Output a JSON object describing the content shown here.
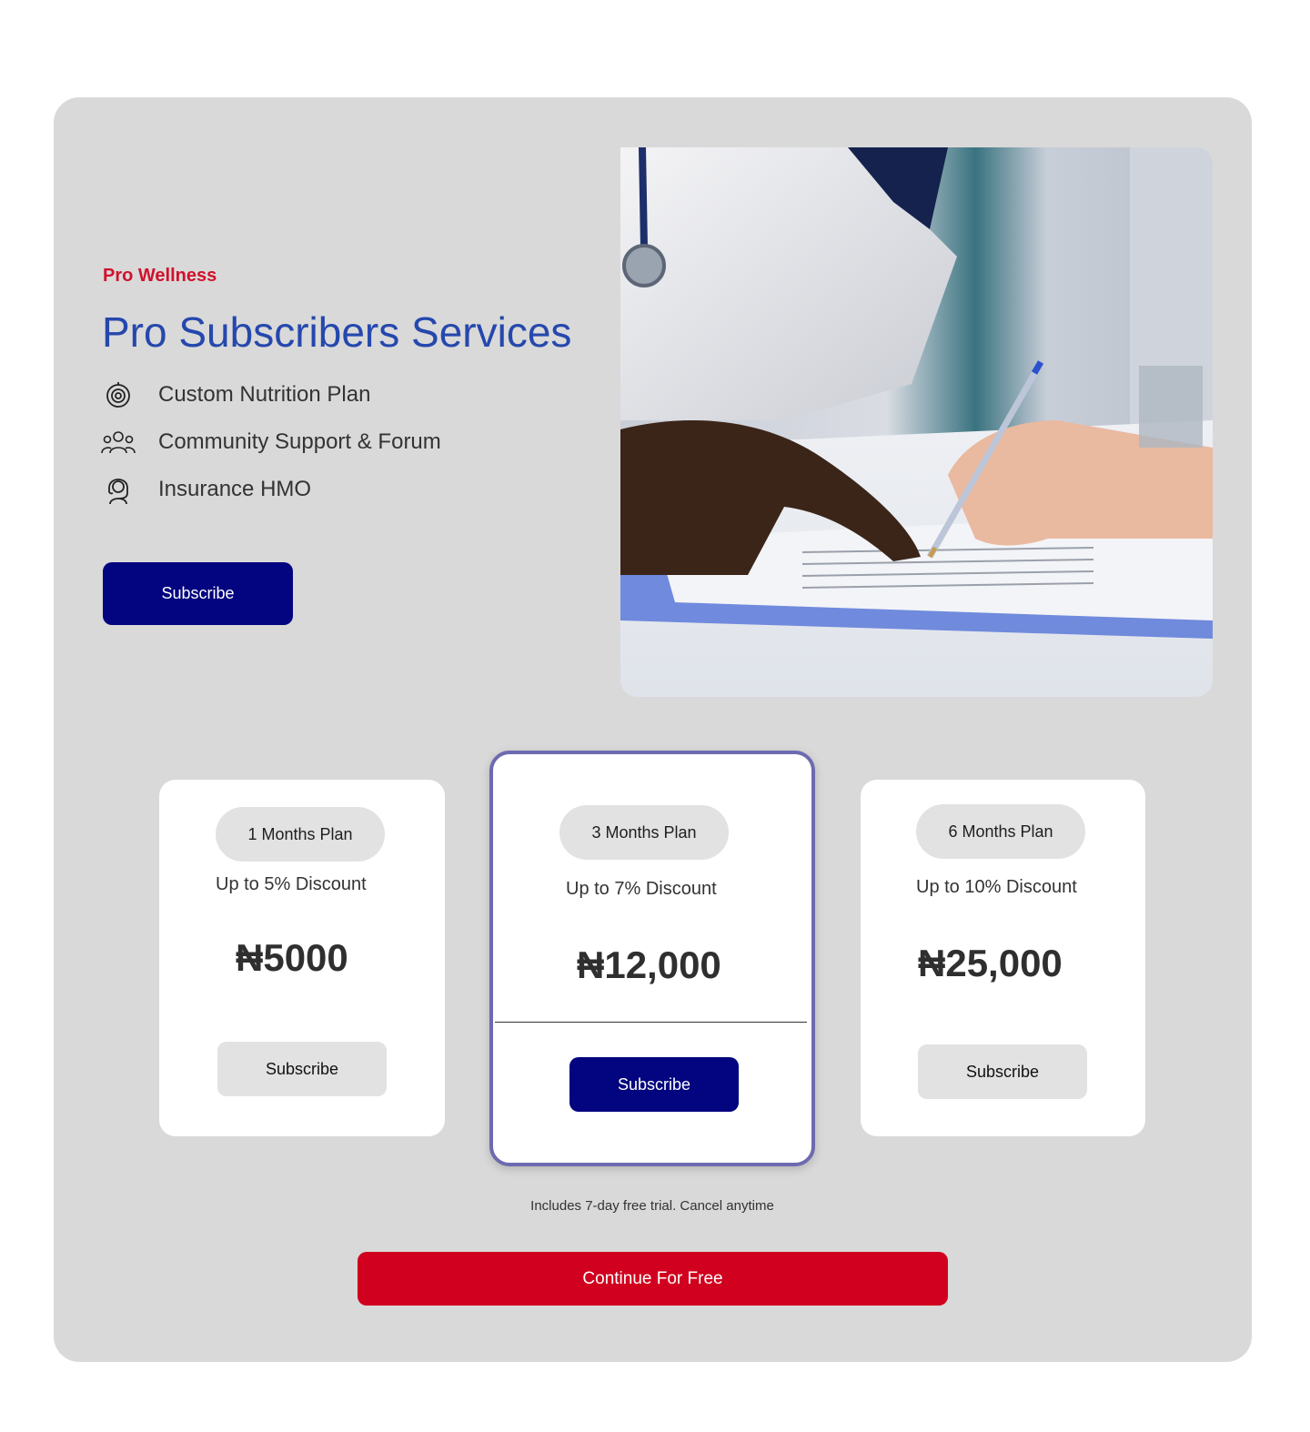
{
  "hero": {
    "eyebrow": "Pro Wellness",
    "title": "Pro Subscribers Services",
    "features": [
      {
        "label": "Custom Nutrition Plan",
        "icon": "target-icon"
      },
      {
        "label": "Community Support & Forum",
        "icon": "users-icon"
      },
      {
        "label": "Insurance HMO",
        "icon": "support-headset-icon"
      }
    ],
    "subscribe_label": "Subscribe"
  },
  "plans": [
    {
      "name": "1 Months Plan",
      "discount": "Up to 5% Discount",
      "price": "₦5000",
      "button": "Subscribe",
      "featured": false
    },
    {
      "name": "3 Months Plan",
      "discount": "Up to 7% Discount",
      "price": "₦12,000",
      "button": "Subscribe",
      "featured": true
    },
    {
      "name": "6 Months Plan",
      "discount": "Up to 10% Discount",
      "price": "₦25,000",
      "button": "Subscribe",
      "featured": false
    }
  ],
  "footer": {
    "trial_note": "Includes 7-day free trial. Cancel anytime",
    "continue_label": "Continue For Free"
  },
  "colors": {
    "accent_red": "#d1112b",
    "title_blue": "#2548ad",
    "primary_navy": "#03047f",
    "panel_gray": "#d9d9d9",
    "cta_red": "#d1001f"
  }
}
